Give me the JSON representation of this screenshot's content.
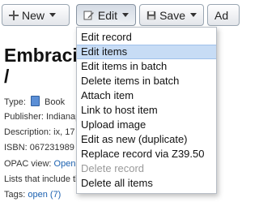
{
  "toolbar": {
    "new_label": "New",
    "edit_label": "Edit",
    "save_label": "Save",
    "add_label": "Ad"
  },
  "record": {
    "title_line1": "Embracin",
    "title_line2": "/",
    "type_label": "Type:",
    "type_value": "Book",
    "publisher_label": "Publisher:",
    "publisher_value": "Indianap",
    "description_label": "Description:",
    "description_value": "ix, 17",
    "isbn_label": "ISBN:",
    "isbn_value": "067231989",
    "opac_label": "OPAC view:",
    "opac_value": "Open",
    "lists_text": "Lists that include th",
    "tags_label": "Tags:",
    "tags_link": "open",
    "tags_count": "(7)"
  },
  "edit_menu": {
    "items": [
      {
        "label": "Edit record",
        "state": "normal"
      },
      {
        "label": "Edit items",
        "state": "highlighted"
      },
      {
        "label": "Edit items in batch",
        "state": "normal"
      },
      {
        "label": "Delete items in batch",
        "state": "normal"
      },
      {
        "label": "Attach item",
        "state": "normal"
      },
      {
        "label": "Link to host item",
        "state": "normal"
      },
      {
        "label": "Upload image",
        "state": "normal"
      },
      {
        "label": "Edit as new (duplicate)",
        "state": "normal"
      },
      {
        "label": "Replace record via Z39.50",
        "state": "normal"
      },
      {
        "label": "Delete record",
        "state": "disabled"
      },
      {
        "label": "Delete all items",
        "state": "normal"
      }
    ]
  },
  "icons": {
    "new": "plus-icon",
    "edit": "pencil-icon",
    "save": "floppy-disk-icon",
    "type": "book-icon"
  }
}
